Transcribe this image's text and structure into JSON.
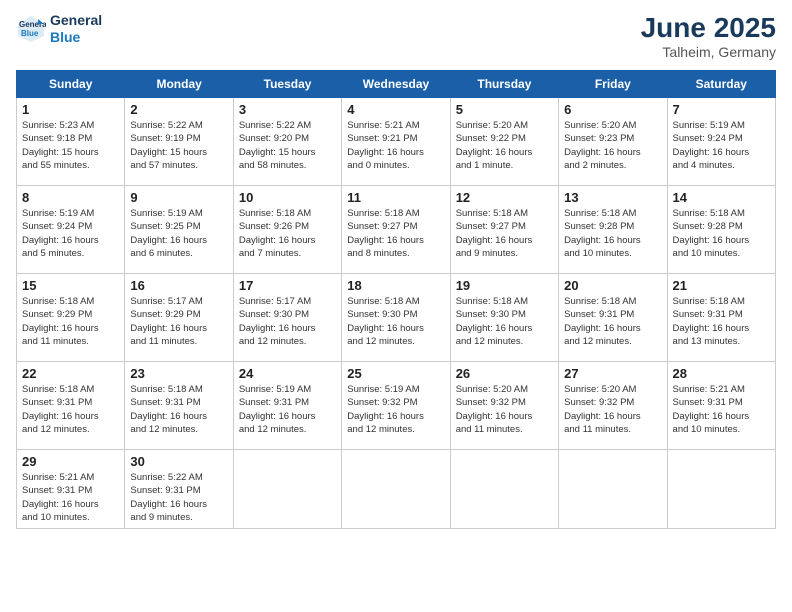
{
  "header": {
    "logo_line1": "General",
    "logo_line2": "Blue",
    "month": "June 2025",
    "location": "Talheim, Germany"
  },
  "weekdays": [
    "Sunday",
    "Monday",
    "Tuesday",
    "Wednesday",
    "Thursday",
    "Friday",
    "Saturday"
  ],
  "weeks": [
    [
      {
        "day": "1",
        "info": "Sunrise: 5:23 AM\nSunset: 9:18 PM\nDaylight: 15 hours\nand 55 minutes."
      },
      {
        "day": "2",
        "info": "Sunrise: 5:22 AM\nSunset: 9:19 PM\nDaylight: 15 hours\nand 57 minutes."
      },
      {
        "day": "3",
        "info": "Sunrise: 5:22 AM\nSunset: 9:20 PM\nDaylight: 15 hours\nand 58 minutes."
      },
      {
        "day": "4",
        "info": "Sunrise: 5:21 AM\nSunset: 9:21 PM\nDaylight: 16 hours\nand 0 minutes."
      },
      {
        "day": "5",
        "info": "Sunrise: 5:20 AM\nSunset: 9:22 PM\nDaylight: 16 hours\nand 1 minute."
      },
      {
        "day": "6",
        "info": "Sunrise: 5:20 AM\nSunset: 9:23 PM\nDaylight: 16 hours\nand 2 minutes."
      },
      {
        "day": "7",
        "info": "Sunrise: 5:19 AM\nSunset: 9:24 PM\nDaylight: 16 hours\nand 4 minutes."
      }
    ],
    [
      {
        "day": "8",
        "info": "Sunrise: 5:19 AM\nSunset: 9:24 PM\nDaylight: 16 hours\nand 5 minutes."
      },
      {
        "day": "9",
        "info": "Sunrise: 5:19 AM\nSunset: 9:25 PM\nDaylight: 16 hours\nand 6 minutes."
      },
      {
        "day": "10",
        "info": "Sunrise: 5:18 AM\nSunset: 9:26 PM\nDaylight: 16 hours\nand 7 minutes."
      },
      {
        "day": "11",
        "info": "Sunrise: 5:18 AM\nSunset: 9:27 PM\nDaylight: 16 hours\nand 8 minutes."
      },
      {
        "day": "12",
        "info": "Sunrise: 5:18 AM\nSunset: 9:27 PM\nDaylight: 16 hours\nand 9 minutes."
      },
      {
        "day": "13",
        "info": "Sunrise: 5:18 AM\nSunset: 9:28 PM\nDaylight: 16 hours\nand 10 minutes."
      },
      {
        "day": "14",
        "info": "Sunrise: 5:18 AM\nSunset: 9:28 PM\nDaylight: 16 hours\nand 10 minutes."
      }
    ],
    [
      {
        "day": "15",
        "info": "Sunrise: 5:18 AM\nSunset: 9:29 PM\nDaylight: 16 hours\nand 11 minutes."
      },
      {
        "day": "16",
        "info": "Sunrise: 5:17 AM\nSunset: 9:29 PM\nDaylight: 16 hours\nand 11 minutes."
      },
      {
        "day": "17",
        "info": "Sunrise: 5:17 AM\nSunset: 9:30 PM\nDaylight: 16 hours\nand 12 minutes."
      },
      {
        "day": "18",
        "info": "Sunrise: 5:18 AM\nSunset: 9:30 PM\nDaylight: 16 hours\nand 12 minutes."
      },
      {
        "day": "19",
        "info": "Sunrise: 5:18 AM\nSunset: 9:30 PM\nDaylight: 16 hours\nand 12 minutes."
      },
      {
        "day": "20",
        "info": "Sunrise: 5:18 AM\nSunset: 9:31 PM\nDaylight: 16 hours\nand 12 minutes."
      },
      {
        "day": "21",
        "info": "Sunrise: 5:18 AM\nSunset: 9:31 PM\nDaylight: 16 hours\nand 13 minutes."
      }
    ],
    [
      {
        "day": "22",
        "info": "Sunrise: 5:18 AM\nSunset: 9:31 PM\nDaylight: 16 hours\nand 12 minutes."
      },
      {
        "day": "23",
        "info": "Sunrise: 5:18 AM\nSunset: 9:31 PM\nDaylight: 16 hours\nand 12 minutes."
      },
      {
        "day": "24",
        "info": "Sunrise: 5:19 AM\nSunset: 9:31 PM\nDaylight: 16 hours\nand 12 minutes."
      },
      {
        "day": "25",
        "info": "Sunrise: 5:19 AM\nSunset: 9:32 PM\nDaylight: 16 hours\nand 12 minutes."
      },
      {
        "day": "26",
        "info": "Sunrise: 5:20 AM\nSunset: 9:32 PM\nDaylight: 16 hours\nand 11 minutes."
      },
      {
        "day": "27",
        "info": "Sunrise: 5:20 AM\nSunset: 9:32 PM\nDaylight: 16 hours\nand 11 minutes."
      },
      {
        "day": "28",
        "info": "Sunrise: 5:21 AM\nSunset: 9:31 PM\nDaylight: 16 hours\nand 10 minutes."
      }
    ],
    [
      {
        "day": "29",
        "info": "Sunrise: 5:21 AM\nSunset: 9:31 PM\nDaylight: 16 hours\nand 10 minutes."
      },
      {
        "day": "30",
        "info": "Sunrise: 5:22 AM\nSunset: 9:31 PM\nDaylight: 16 hours\nand 9 minutes."
      },
      {
        "day": "",
        "info": ""
      },
      {
        "day": "",
        "info": ""
      },
      {
        "day": "",
        "info": ""
      },
      {
        "day": "",
        "info": ""
      },
      {
        "day": "",
        "info": ""
      }
    ]
  ]
}
